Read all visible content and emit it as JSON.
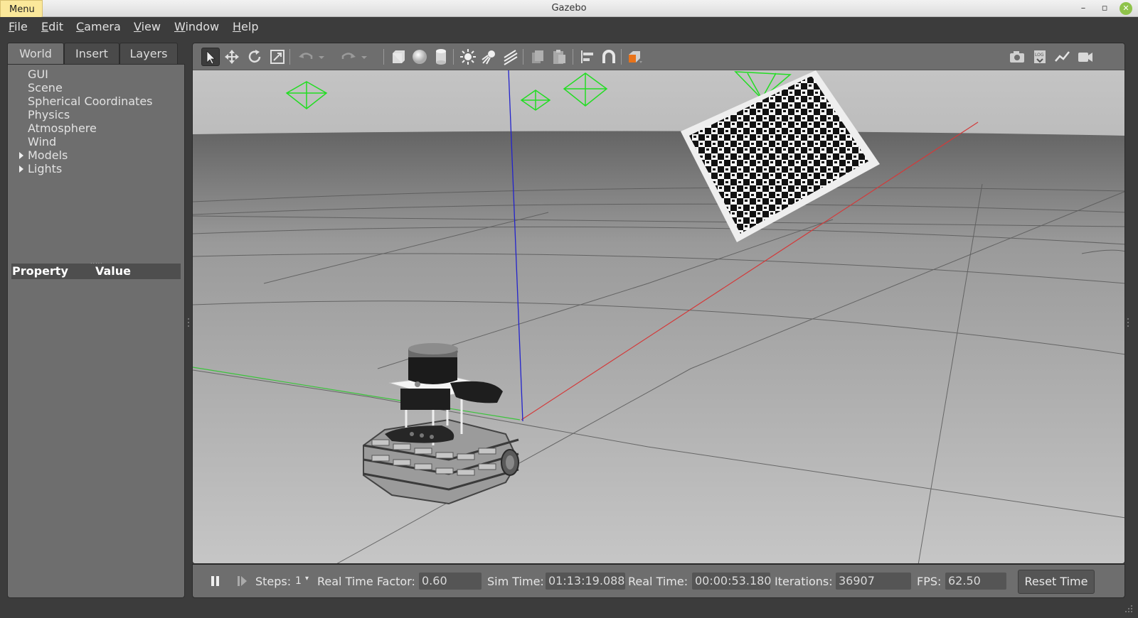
{
  "window": {
    "title": "Gazebo",
    "menu_badge": "Menu",
    "minimize": "–",
    "restore": "▫",
    "close": "✕"
  },
  "menubar": [
    {
      "label": "File",
      "mnemonic": "F"
    },
    {
      "label": "Edit",
      "mnemonic": "E"
    },
    {
      "label": "Camera",
      "mnemonic": "C"
    },
    {
      "label": "View",
      "mnemonic": "V"
    },
    {
      "label": "Window",
      "mnemonic": "W"
    },
    {
      "label": "Help",
      "mnemonic": "H"
    }
  ],
  "left_panel": {
    "tabs": [
      {
        "label": "World",
        "active": true
      },
      {
        "label": "Insert",
        "active": false
      },
      {
        "label": "Layers",
        "active": false
      }
    ],
    "tree": [
      {
        "label": "GUI",
        "expandable": false
      },
      {
        "label": "Scene",
        "expandable": false
      },
      {
        "label": "Spherical Coordinates",
        "expandable": false
      },
      {
        "label": "Physics",
        "expandable": false
      },
      {
        "label": "Atmosphere",
        "expandable": false
      },
      {
        "label": "Wind",
        "expandable": false
      },
      {
        "label": "Models",
        "expandable": true
      },
      {
        "label": "Lights",
        "expandable": true
      }
    ],
    "property_header": {
      "property": "Property",
      "value": "Value"
    }
  },
  "toolbar": {
    "tools": [
      "select-mode-icon",
      "translate-mode-icon",
      "rotate-mode-icon",
      "scale-mode-icon",
      "undo-icon",
      "redo-icon",
      "box-shape-icon",
      "sphere-shape-icon",
      "cylinder-shape-icon",
      "point-light-icon",
      "spot-light-icon",
      "directional-light-icon",
      "copy-icon",
      "paste-icon",
      "align-icon",
      "snap-icon",
      "view-angle-icon",
      "screenshot-icon",
      "log-icon",
      "plot-icon",
      "video-record-icon"
    ],
    "accent_orange": "#e8731a"
  },
  "status": {
    "steps_label": "Steps:",
    "steps_value": "1",
    "rtf_label": "Real Time Factor:",
    "rtf_value": "0.60",
    "sim_time_label": "Sim Time:",
    "sim_time_value": "01:13:19.088",
    "real_time_label": "Real Time:",
    "real_time_value": "00:00:53.180",
    "iterations_label": "Iterations:",
    "iterations_value": "36907",
    "fps_label": "FPS:",
    "fps_value": "62.50",
    "reset_label": "Reset Time"
  },
  "scene": {
    "axis_colors": {
      "x": "#d03030",
      "y": "#30c030",
      "z": "#2020d0"
    },
    "light_marker_color": "#22dd22"
  }
}
